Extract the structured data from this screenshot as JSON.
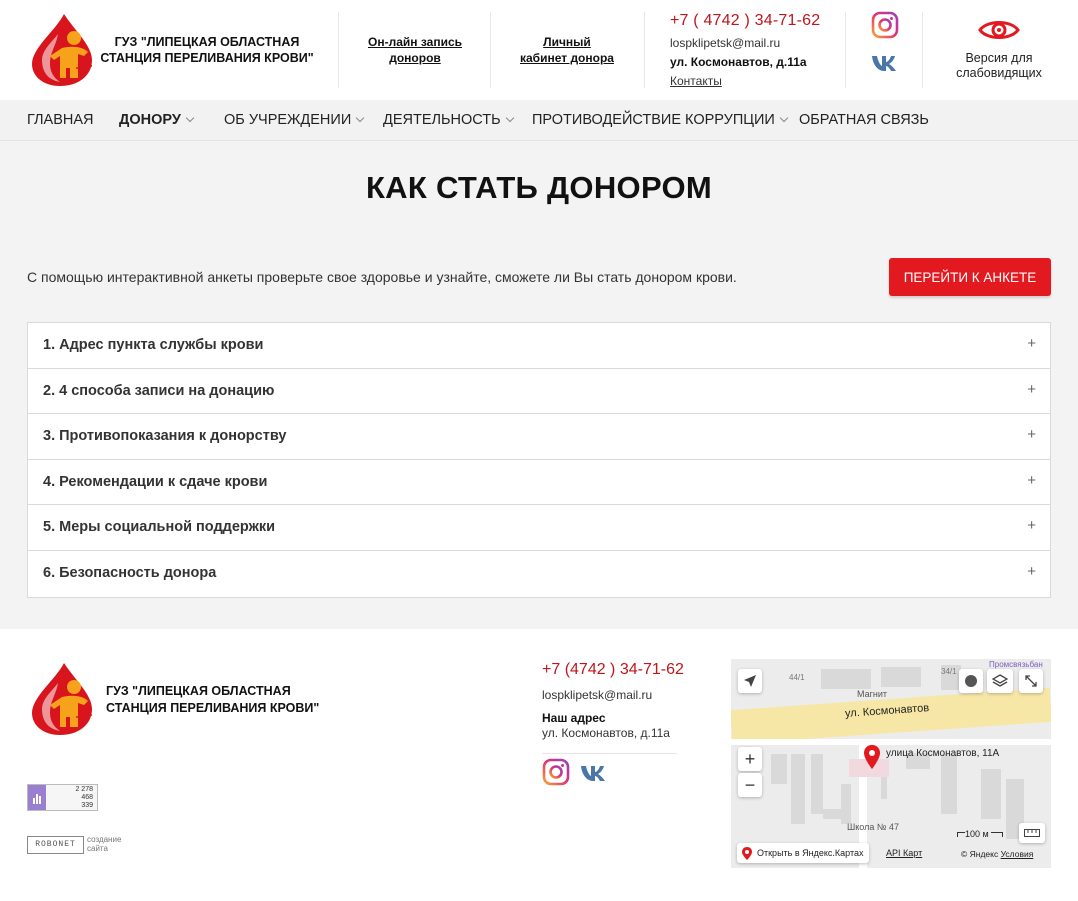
{
  "header": {
    "org_name": "ГУЗ \"ЛИПЕЦКАЯ ОБЛАСТНАЯ СТАНЦИЯ ПЕРЕЛИВАНИЯ КРОВИ\"",
    "online_record_line1": "Он-лайн запись",
    "online_record_line2": "доноров",
    "cabinet_line1": "Личный",
    "cabinet_line2": "кабинет донора",
    "phone": "+7 ( 4742 ) 34-71-62",
    "email": "lospklipetsk@mail.ru",
    "address": "ул. Космонавтов, д.11а",
    "contacts": "Контакты",
    "social_icons": [
      "instagram-icon",
      "vk-icon"
    ],
    "accessibility_line1": "Версия для",
    "accessibility_line2": "слабовидящих"
  },
  "nav": {
    "items": [
      {
        "label": "ГЛАВНАЯ",
        "dropdown": false
      },
      {
        "label": "ДОНОРУ",
        "dropdown": true,
        "active": true
      },
      {
        "label": "ОБ УЧРЕЖДЕНИИ",
        "dropdown": true
      },
      {
        "label": "ДЕЯТЕЛЬНОСТЬ",
        "dropdown": true
      },
      {
        "label": "ПРОТИВОДЕЙСТВИЕ КОРРУПЦИИ",
        "dropdown": true
      },
      {
        "label": "ОБРАТНАЯ СВЯЗЬ",
        "dropdown": false
      }
    ]
  },
  "main": {
    "title": "КАК СТАТЬ ДОНОРОМ",
    "intro": "С помощью интерактивной анкеты проверьте свое здоровье и узнайте, сможете ли Вы стать донором крови.",
    "cta": "ПЕРЕЙТИ К АНКЕТЕ",
    "accordion": [
      "1. Адрес пункта службы крови",
      "2. 4 способа записи на донацию",
      "3. Противопоказания к донорству",
      "4. Рекомендации к сдаче крови",
      "5. Меры социальной поддержки",
      "6. Безопасность донора"
    ],
    "expand_symbol": "+"
  },
  "footer": {
    "org_name": "ГУЗ \"ЛИПЕЦКАЯ ОБЛАСТНАЯ СТАНЦИЯ ПЕРЕЛИВАНИЯ КРОВИ\"",
    "counter": [
      "2 278",
      "468",
      "339"
    ],
    "robonet": "ROBONET",
    "robonet_caption_line1": "создание",
    "robonet_caption_line2": "сайта",
    "phone": "+7 (4742 ) 34-71-62",
    "email": "lospklipetsk@mail.ru",
    "address_title": "Наш адрес",
    "address": "ул. Космонавтов, д.11а"
  },
  "map": {
    "street": "ул. Космонавтов",
    "marker_label": "улица Космонавтов, 11А",
    "poi_magnit": "Магнит",
    "poi_school": "Школа № 47",
    "poi_top": "Промсвязьбан",
    "open_link": "Открыть в Яндекс.Картах",
    "api_link": "API Карт",
    "copyright": "© Яндекс",
    "terms": "Условия",
    "scale": "100 м",
    "zoom_in": "+",
    "zoom_out": "−"
  },
  "colors": {
    "accent_red": "#e2191f",
    "phone_red": "#c0151c",
    "nav_bg": "#f2f2f2",
    "main_bg": "#f3f3f3"
  }
}
